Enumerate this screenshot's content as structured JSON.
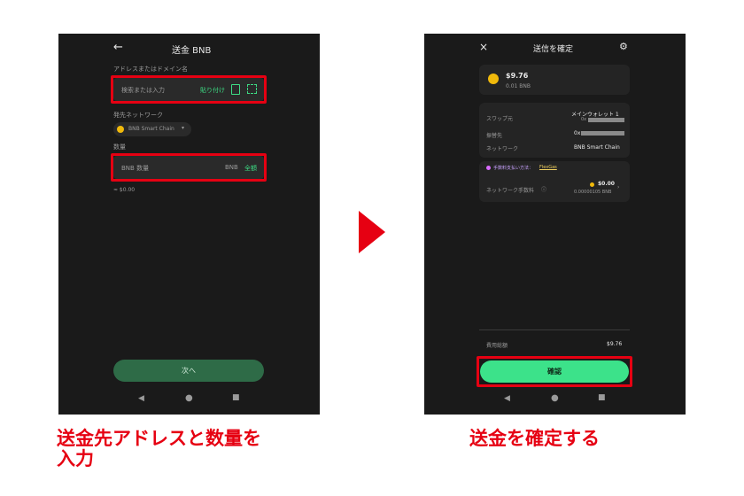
{
  "left_screen": {
    "title": "送金 BNB",
    "address_label": "アドレスまたはドメイン名",
    "address_placeholder": "検索または入力",
    "paste_label": "貼り付け",
    "network_label": "発先ネットワーク",
    "network_value": "BNB Smart Chain",
    "amount_label": "数量",
    "amount_placeholder": "BNB 数量",
    "amount_unit": "BNB",
    "all_label": "全額",
    "fiat_value": "≈ $0.00",
    "next_button": "次へ"
  },
  "right_screen": {
    "title": "送信を確定",
    "amount_usd": "$9.76",
    "amount_bnb": "0.01 BNB",
    "from_label": "スワップ元",
    "from_value": "メインウォレット 1",
    "from_addr_prefix": "0x",
    "to_label": "振替先",
    "to_addr_prefix": "0x",
    "network_label": "ネットワーク",
    "network_value": "BNB Smart Chain",
    "fee_method_label": "手数料支払い方法：",
    "fee_method_value": "FlexGas",
    "fee_label": "ネットワーク手数料",
    "fee_usd": "$0.00",
    "fee_bnb": "0.00000105 BNB",
    "total_label": "費用総額",
    "total_value": "$9.76",
    "confirm_button": "確認"
  },
  "captions": {
    "left_line1": "送金先アドレスと数量を",
    "left_line2": "入力",
    "right": "送金を確定する"
  },
  "colors": {
    "accent_red": "#e60012",
    "accent_green": "#3ddc84",
    "bnb_yellow": "#f0b90b"
  }
}
